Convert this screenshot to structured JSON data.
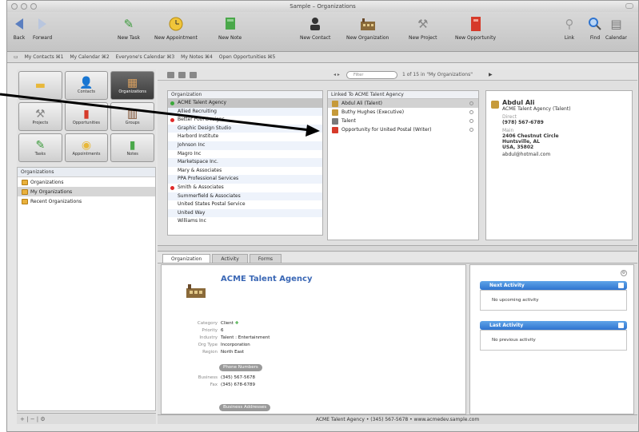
{
  "window": {
    "title": "Sample – Organizations"
  },
  "toolbar": {
    "back": "Back",
    "forward": "Forward",
    "new_task": "New Task",
    "new_appointment": "New Appointment",
    "new_note": "New Note",
    "new_contact": "New Contact",
    "new_organization": "New Organization",
    "new_project": "New Project",
    "new_opportunity": "New Opportunity",
    "link": "Link",
    "find": "Find",
    "calendar": "Calendar"
  },
  "bookmarks": [
    "My Contacts ⌘1",
    "My Calendar ⌘2",
    "Everyone's Calendar ⌘3",
    "My Notes ⌘4",
    "Open Opportunities ⌘5"
  ],
  "categories": [
    {
      "label": "",
      "icon": "notepad-icon"
    },
    {
      "label": "Contacts",
      "icon": "person-icon"
    },
    {
      "label": "Organizations",
      "icon": "building-icon"
    },
    {
      "label": "Projects",
      "icon": "tools-icon"
    },
    {
      "label": "Opportunities",
      "icon": "briefcase-icon"
    },
    {
      "label": "Groups",
      "icon": "books-icon"
    },
    {
      "label": "Tasks",
      "icon": "pushpin-icon"
    },
    {
      "label": "Appointments",
      "icon": "clock-icon"
    },
    {
      "label": "Notes",
      "icon": "note-icon"
    }
  ],
  "groups": {
    "header": "Organizations",
    "items": [
      "Organizations",
      "My Organizations",
      "Recent Organizations"
    ]
  },
  "search": {
    "placeholder": "Filter",
    "count_text": "1 of 15 in \"My Organizations\""
  },
  "org_list": {
    "header": "Organization",
    "rows": [
      "ACME Talent Agency",
      "Allied Recruiting",
      "Better Pool Designs",
      "Graphic Design Studio",
      "Harbord Institute",
      "Johnson Inc",
      "Magro Inc",
      "Marketspace Inc.",
      "Mary & Associates",
      "PPA Professional Services",
      "Smith & Associates",
      "Summerfield & Associates",
      "United States Postal Service",
      "United Way",
      "Williams Inc"
    ]
  },
  "linked": {
    "header": "Linked To ACME Talent Agency",
    "rows": [
      "Abdul Ali (Talent)",
      "Buthy Hughes (Executive)",
      "Talent",
      "Opportunity for United Postal (Writer)"
    ]
  },
  "card": {
    "name": "Abdul Ali",
    "title": "ACME Talent Agency (Talent)",
    "phone_label": "Direct",
    "phone": "(978) 567-6789",
    "addr_label": "Main",
    "addr1": "2406 Chestnut Circle",
    "addr2": "Huntsville, AL",
    "addr3": "USA, 35802",
    "email": "abdul@hotmail.com"
  },
  "tabs": [
    "Organization",
    "Activity",
    "Forms"
  ],
  "detail": {
    "name": "ACME Talent Agency",
    "fields": [
      {
        "label": "Category",
        "value": "Client"
      },
      {
        "label": "Priority",
        "value": "6"
      },
      {
        "label": "Industry",
        "value": "Talent : Entertainment"
      },
      {
        "label": "Org Type",
        "value": "Incorporation"
      },
      {
        "label": "Region",
        "value": "North East"
      }
    ],
    "phones_pill": "Phone Numbers",
    "business_label": "Business",
    "business": "(345) 567-5678",
    "fax_label": "Fax",
    "fax": "(345) 678-6789",
    "address_pill": "Business Addresses"
  },
  "activity": {
    "next_title": "Next Activity",
    "next_body": "No upcoming activity",
    "last_title": "Last Activity",
    "last_body": "No previous activity"
  },
  "status_bar": "ACME Talent Agency • (345) 567-5678 • www.acmedev.sample.com",
  "colors": {
    "accent": "#3a67b5",
    "selection": "#c4c4c4",
    "activity_header": "#2f74cf"
  }
}
